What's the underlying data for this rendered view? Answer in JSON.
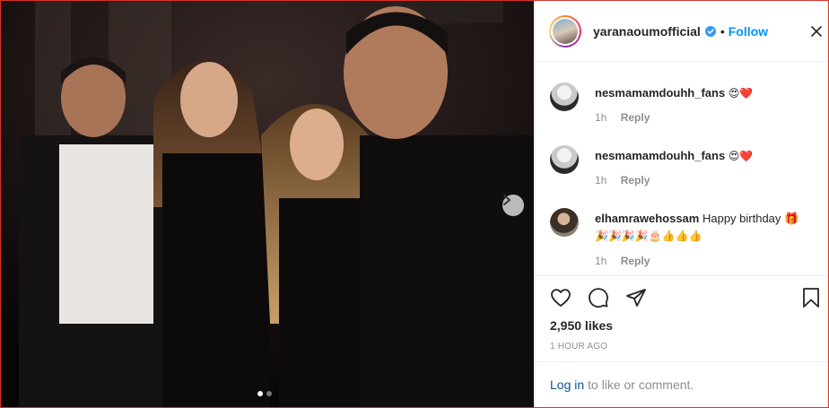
{
  "post": {
    "username": "yaranaoumofficial",
    "separator": "•",
    "follow_label": "Follow",
    "photo_description_icon": "carousel-photo",
    "carousel": {
      "current": 1,
      "total": 2
    }
  },
  "comments": [
    {
      "user": "nesmamamdouhh_fans",
      "text": "😍❤️",
      "time": "1h",
      "reply": "Reply"
    },
    {
      "user": "nesmamamdouhh_fans",
      "text": "😍❤️",
      "time": "1h",
      "reply": "Reply"
    },
    {
      "user": "elhamrawehossam",
      "text": "Happy birthday 🎁",
      "text2": "🎉🎉🎉🎉🎂👍👍👍",
      "time": "1h",
      "reply": "Reply"
    }
  ],
  "stats": {
    "likes": "2,950 likes",
    "time_ago": "1 HOUR AGO"
  },
  "footer": {
    "login": "Log in",
    "rest": " to like or comment."
  },
  "icons": [
    "heart-icon",
    "comment-icon",
    "share-icon",
    "bookmark-icon",
    "chevron-right-icon",
    "verified-badge-icon",
    "close-icon"
  ],
  "colors": {
    "accent": "#0095f6",
    "text": "#262626",
    "muted": "#8e8e8e",
    "frame": "#d9322b"
  }
}
